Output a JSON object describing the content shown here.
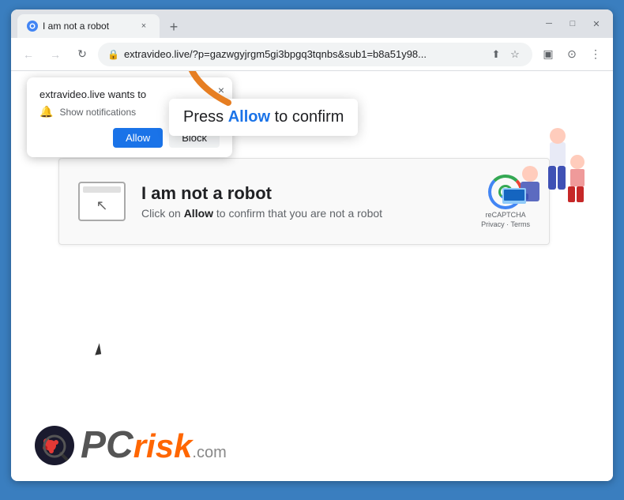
{
  "browser": {
    "title": "I am not a robot",
    "tab_close": "×",
    "new_tab": "+",
    "nav": {
      "back": "←",
      "forward": "→",
      "reload": "↻"
    },
    "url": "extravideo.live/?p=gazwgyjrgm5gi3bpgq3tqnbs&sub1=b8a51y98...",
    "window_controls": {
      "minimize": "─",
      "maximize": "□",
      "close": "✕"
    }
  },
  "notification": {
    "title": "extravideo.live wants to",
    "description": "Show notifications",
    "allow_label": "Allow",
    "block_label": "Block",
    "close": "×"
  },
  "tooltip": {
    "prefix": "Press ",
    "highlight": "Allow",
    "suffix": " to confirm"
  },
  "captcha": {
    "title": "I am not a robot",
    "description_prefix": "Click on ",
    "description_bold": "Allow",
    "description_suffix": " to confirm that you are not a robot",
    "recaptcha_label": "reCAPTCHA",
    "recaptcha_links": "Privacy · Terms"
  },
  "logo": {
    "pc": "PC",
    "risk": "risk",
    "dot": ".",
    "com": "com"
  },
  "icons": {
    "lock": "🔒",
    "bell": "🔔",
    "share": "⬆",
    "star": "☆",
    "sidebar": "▣",
    "profile": "⊙",
    "menu": "⋮"
  }
}
